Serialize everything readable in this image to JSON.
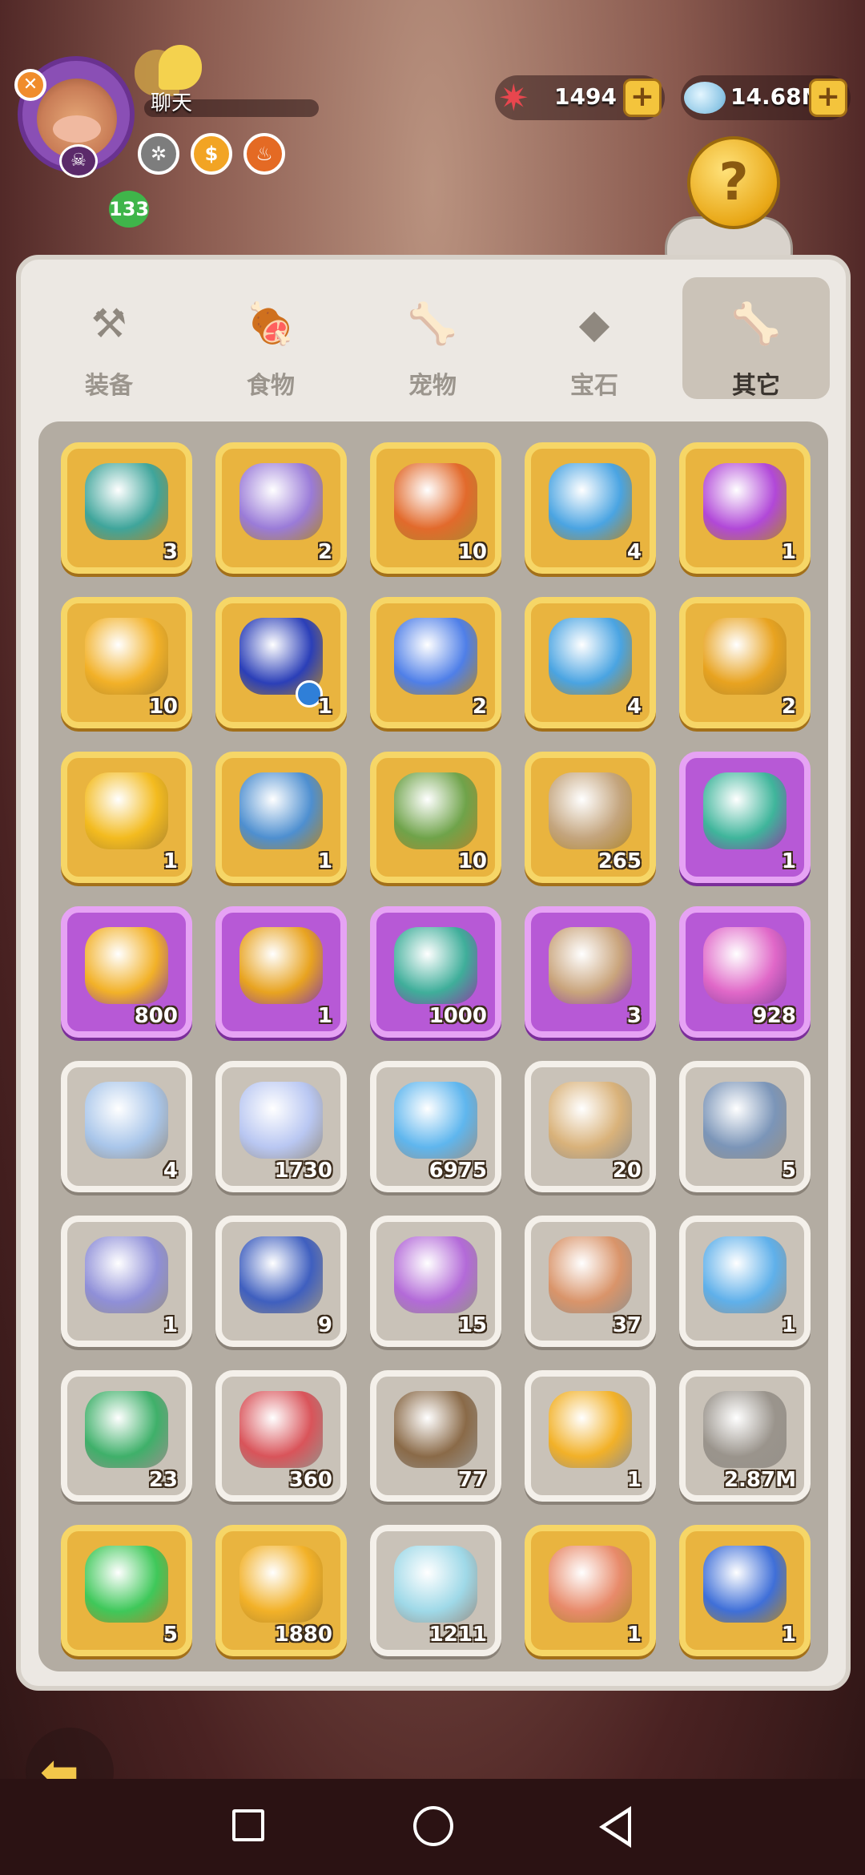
{
  "header": {
    "player_level": "133",
    "chat_label": "聊天",
    "currencies": [
      {
        "name": "starfish",
        "value": "1494",
        "color": "#e8464e"
      },
      {
        "name": "crystal",
        "value": "14.68M",
        "color": "#9fd6f0"
      }
    ],
    "status_icons": [
      {
        "icon": "paw-badge-icon",
        "color": "#7d7d7d",
        "glyph": "✲"
      },
      {
        "icon": "coin-badge-icon",
        "color": "#f2a424",
        "glyph": "$"
      },
      {
        "icon": "fire-badge-icon",
        "color": "#e46a24",
        "glyph": "♨"
      }
    ]
  },
  "tabs": [
    {
      "label": "装备",
      "icon": "equipment-icon",
      "glyph": "⚒",
      "active": false
    },
    {
      "label": "食物",
      "icon": "food-icon",
      "glyph": "🍖",
      "active": false
    },
    {
      "label": "宠物",
      "icon": "pet-icon",
      "glyph": "🦴",
      "active": false
    },
    {
      "label": "宝石",
      "icon": "gem-icon",
      "glyph": "◆",
      "active": false
    },
    {
      "label": "其它",
      "icon": "bone-icon",
      "glyph": "🦴",
      "active": true
    }
  ],
  "items": [
    {
      "icon": "carrot-bag-icon",
      "count": "3",
      "rarity": "gold",
      "color": "#3fa59b"
    },
    {
      "icon": "pet-bag-icon",
      "count": "2",
      "rarity": "gold",
      "color": "#9a7bd8"
    },
    {
      "icon": "chest-icon",
      "count": "10",
      "rarity": "gold",
      "color": "#e26a2c"
    },
    {
      "icon": "gem-bag-icon",
      "count": "4",
      "rarity": "gold",
      "color": "#4aa4e2"
    },
    {
      "icon": "purple-bag-icon",
      "count": "1",
      "rarity": "gold",
      "color": "#b148d8"
    },
    {
      "icon": "gold-coin-icon",
      "count": "10",
      "rarity": "gold",
      "color": "#f2b128"
    },
    {
      "icon": "skill-orb-icon",
      "count": "1",
      "rarity": "gold",
      "color": "#2b3fb8"
    },
    {
      "icon": "paw-shield-icon",
      "count": "2",
      "rarity": "gold",
      "color": "#4f7fe8"
    },
    {
      "icon": "gem-bag-icon",
      "count": "4",
      "rarity": "gold",
      "color": "#4aa4e2"
    },
    {
      "icon": "swirl-bag-icon",
      "count": "2",
      "rarity": "gold",
      "color": "#e8a320"
    },
    {
      "icon": "gold-egg-icon",
      "count": "1",
      "rarity": "gold",
      "color": "#f3bb1f"
    },
    {
      "icon": "blue-ticket-icon",
      "count": "1",
      "rarity": "gold",
      "color": "#4e8fd0"
    },
    {
      "icon": "green-statue-icon",
      "count": "10",
      "rarity": "gold",
      "color": "#6fa34a"
    },
    {
      "icon": "stone-statue-icon",
      "count": "265",
      "rarity": "gold",
      "color": "#c4a57e"
    },
    {
      "icon": "crystal-bag-icon",
      "count": "1",
      "rarity": "purple",
      "color": "#3fb59b"
    },
    {
      "icon": "star-badge-icon",
      "count": "800",
      "rarity": "purple",
      "color": "#f2b128"
    },
    {
      "icon": "swirl-bag-icon",
      "count": "1",
      "rarity": "purple",
      "color": "#e8a320"
    },
    {
      "icon": "green-ticket-icon",
      "count": "1000",
      "rarity": "purple",
      "color": "#3fae9a"
    },
    {
      "icon": "mystery-bone-icon",
      "count": "3",
      "rarity": "purple",
      "color": "#c9a47c"
    },
    {
      "icon": "pink-crystal-icon",
      "count": "928",
      "rarity": "purple",
      "color": "#e068c8"
    },
    {
      "icon": "moon-shard-icon",
      "count": "4",
      "rarity": "grey",
      "color": "#a9c6ea"
    },
    {
      "icon": "star-shard-icon",
      "count": "1730",
      "rarity": "grey",
      "color": "#b9c7f2"
    },
    {
      "icon": "blue-crystal-icon",
      "count": "6975",
      "rarity": "grey",
      "color": "#5fb6ee"
    },
    {
      "icon": "spotted-bag-icon",
      "count": "20",
      "rarity": "grey",
      "color": "#d9b27a"
    },
    {
      "icon": "treasure-chest-icon",
      "count": "5",
      "rarity": "grey",
      "color": "#7b95b8"
    },
    {
      "icon": "character-card-icon",
      "count": "1",
      "rarity": "grey",
      "color": "#8f8fd8"
    },
    {
      "icon": "blue-rune-stone-icon",
      "count": "9",
      "rarity": "grey",
      "color": "#3f5fbf"
    },
    {
      "icon": "purple-ticket-icon",
      "count": "15",
      "rarity": "grey",
      "color": "#b36ad8"
    },
    {
      "icon": "paw-ticket-icon",
      "count": "37",
      "rarity": "grey",
      "color": "#d9946a"
    },
    {
      "icon": "blue-card-icon",
      "count": "1",
      "rarity": "grey",
      "color": "#5fb0ea"
    },
    {
      "icon": "lightning-ticket-icon",
      "count": "23",
      "rarity": "grey",
      "color": "#3fb06a"
    },
    {
      "icon": "red-ticket-icon",
      "count": "360",
      "rarity": "grey",
      "color": "#d9545a"
    },
    {
      "icon": "play-ticket-icon",
      "count": "77",
      "rarity": "grey",
      "color": "#8a6a48"
    },
    {
      "icon": "shell-coin-icon",
      "count": "1",
      "rarity": "grey",
      "color": "#f2b128"
    },
    {
      "icon": "swirl-stone-icon",
      "count": "2.87M",
      "rarity": "grey",
      "color": "#9a948c"
    },
    {
      "icon": "green-orb-icon",
      "count": "5",
      "rarity": "gold",
      "color": "#3fc85a"
    },
    {
      "icon": "rune-coin-icon",
      "count": "1880",
      "rarity": "gold",
      "color": "#f2b128"
    },
    {
      "icon": "rainbow-crystal-icon",
      "count": "1211",
      "rarity": "grey",
      "color": "#9fd9e8"
    },
    {
      "icon": "photo-card-icon",
      "count": "1",
      "rarity": "gold",
      "color": "#e88a6a"
    },
    {
      "icon": "sonic-card-icon",
      "count": "1",
      "rarity": "gold",
      "color": "#3f6fd8"
    }
  ]
}
